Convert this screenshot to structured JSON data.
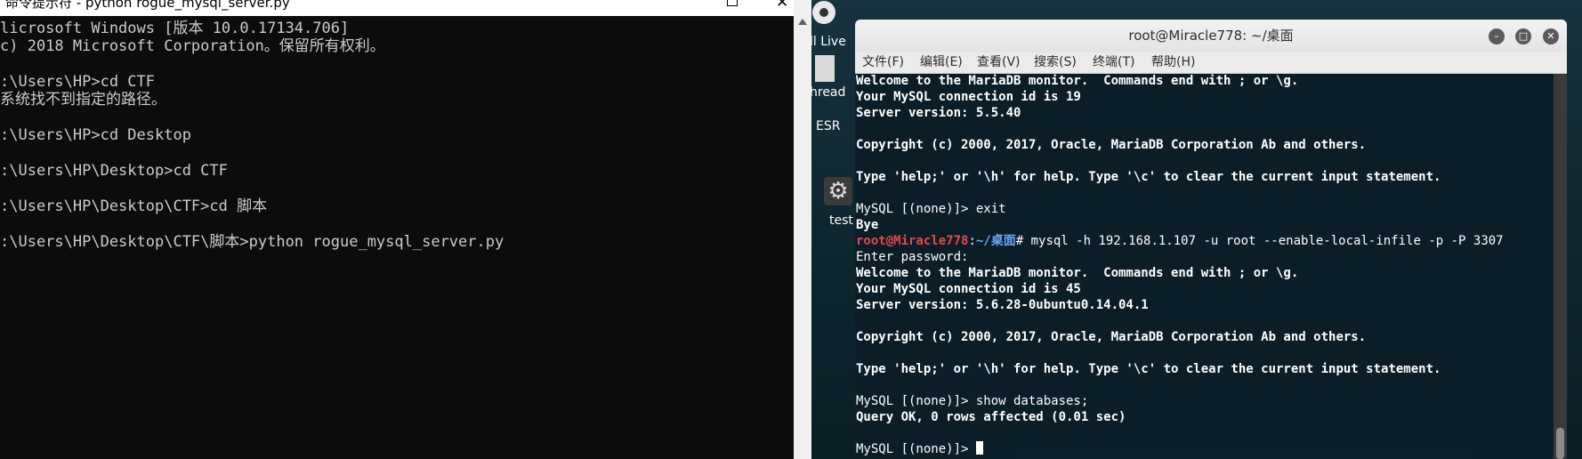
{
  "cmd": {
    "title": "命令提示符 - python rogue_mysql_server.py",
    "controls": {
      "close": "✕"
    },
    "lines": [
      "licrosoft Windows [版本 10.0.17134.706]",
      "c) 2018 Microsoft Corporation。保留所有权利。",
      "",
      ":\\Users\\HP>cd CTF",
      "系统找不到指定的路径。",
      "",
      ":\\Users\\HP>cd Desktop",
      "",
      ":\\Users\\HP\\Desktop>cd CTF",
      "",
      ":\\Users\\HP\\Desktop\\CTF>cd 脚本",
      "",
      ":\\Users\\HP\\Desktop\\CTF\\脚本>python rogue_mysql_server.py"
    ]
  },
  "desktop": {
    "icons": {
      "live": "ll Live",
      "thread": "hread",
      "esr": "ESR",
      "test": "test",
      "gear": "⚙"
    }
  },
  "terminal": {
    "title": "root@Miracle778: ~/桌面",
    "buttons": {
      "minimize": "–",
      "maximize": "□",
      "close": "✕"
    },
    "menu": [
      "文件(F)",
      "编辑(E)",
      "查看(V)",
      "搜索(S)",
      "终端(T)",
      "帮助(H)"
    ],
    "lines": [
      "Welcome to the MariaDB monitor.  Commands end with ; or \\g.",
      "Your MySQL connection id is 19",
      "Server version: 5.5.40",
      "",
      "Copyright (c) 2000, 2017, Oracle, MariaDB Corporation Ab and others.",
      "",
      "Type 'help;' or '\\h' for help. Type '\\c' to clear the current input statement.",
      "",
      "MySQL [(none)]> exit",
      "Bye"
    ],
    "prompt": {
      "user": "root@Miracle778",
      "sep": ":",
      "dir": "~/桌面",
      "command": "# mysql -h 192.168.1.107 -u root --enable-local-infile -p -P 3307"
    },
    "lines2": [
      "Enter password: ",
      "Welcome to the MariaDB monitor.  Commands end with ; or \\g.",
      "Your MySQL connection id is 45",
      "Server version: 5.6.28-0ubuntu0.14.04.1",
      "",
      "Copyright (c) 2000, 2017, Oracle, MariaDB Corporation Ab and others.",
      "",
      "Type 'help;' or '\\h' for help. Type '\\c' to clear the current input statement.",
      "",
      "MySQL [(none)]> show databases;",
      "Query OK, 0 rows affected (0.01 sec)",
      ""
    ],
    "final_prompt": "MySQL [(none)]> "
  }
}
